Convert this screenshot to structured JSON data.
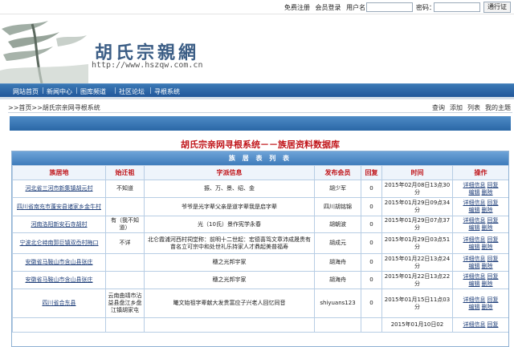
{
  "topbar": {
    "register": "免费注册",
    "member_login": "会员登录",
    "username_label": "用户名：",
    "password_label": "密码：",
    "login_button": "通行证"
  },
  "banner": {
    "logo_text": "胡氏宗親網",
    "url_text": "http://www.hszqw.com.cn"
  },
  "nav": {
    "items": [
      "网站首页",
      "新闻中心",
      "图库频道",
      "社区论坛",
      "寻根系统"
    ]
  },
  "breadcrumb": {
    "text": ">>首页>>胡氏宗亲网寻根系统",
    "tools": [
      "查询",
      "添加",
      "列表",
      "我的主题"
    ]
  },
  "system_title": "胡氏宗亲网寻根系统－－族居资料数据库",
  "table": {
    "caption": "族 居 表 列 表",
    "headers": [
      "族居地",
      "始迁祖",
      "字派信息",
      "发布会员",
      "回复",
      "时间",
      "操作"
    ],
    "rows": [
      {
        "place": "河北省三河市新集镇胡元村",
        "ancestor": "不知道",
        "info": "振、万、景、绍、金",
        "member": "胡少军",
        "replies": "0",
        "time": "2015年02月08日13点30分",
        "ops": [
          "详细信息",
          "回复",
          "编辑",
          "删除"
        ]
      },
      {
        "place": "四川省南充市蓬安县诸家乡金牛村",
        "ancestor": "",
        "info": "爷爷是光字辈父亲是道字辈我是启字辈",
        "member": "四川胡铭锦",
        "replies": "0",
        "time": "2015年01月29日09点34分",
        "ops": [
          "详细信息",
          "回复",
          "编辑",
          "删除"
        ]
      },
      {
        "place": "河南洛阳新安石寺胡村",
        "ancestor": "有（我不知道）",
        "info": "光（10氏）景作宪学永春",
        "member": "胡朝波",
        "replies": "0",
        "time": "2015年01月29日07点37分",
        "ops": [
          "详细信息",
          "回复",
          "编辑",
          "删除"
        ]
      },
      {
        "place": "宁波北仑峙南郭巨镇双岙村梅口",
        "ancestor": "不详",
        "info": "北仑霞浦河西村祠堂称：前明十二世起：宏德喜笃文章沛成晟贵有苗名立可宗中和处世礼乐持家人才鼎起美普福寿",
        "member": "胡成元",
        "replies": "0",
        "time": "2015年01月29日03点51分",
        "ops": [
          "详细信息",
          "回复",
          "编辑",
          "删除"
        ]
      },
      {
        "place": "安徽省马鞍山市含山县张庄",
        "ancestor": "",
        "info": "穗之光邦宇家",
        "member": "胡海舟",
        "replies": "0",
        "time": "2015年01月22日13点24分",
        "ops": [
          "详细信息",
          "回复",
          "编辑",
          "删除"
        ]
      },
      {
        "place": "安徽省马鞍山市含山县张庄",
        "ancestor": "",
        "info": "穗之光邦宇家",
        "member": "胡海舟",
        "replies": "0",
        "time": "2015年01月22日13点22分",
        "ops": [
          "详细信息",
          "回复",
          "编辑",
          "删除"
        ]
      },
      {
        "place": "四川省合东县",
        "ancestor": "云南曲靖市沾益县盘江乡盘江镇胡家屯",
        "info": "曦文始祖字辈献大发贵富应子兴老人回忆同音",
        "member": "shiyuans123",
        "replies": "0",
        "time": "2015年01月15日11点03分",
        "ops": [
          "详细信息",
          "回复",
          "编辑",
          "删除"
        ]
      },
      {
        "place": "",
        "ancestor": "",
        "info": "",
        "member": "",
        "replies": "",
        "time": "2015年01月10日02",
        "ops": [
          "详细信息",
          "回复"
        ]
      }
    ]
  },
  "colors": {
    "nav_blue": "#2a67a6",
    "title_red": "#c0151a",
    "link_blue": "#1f3f7a"
  }
}
